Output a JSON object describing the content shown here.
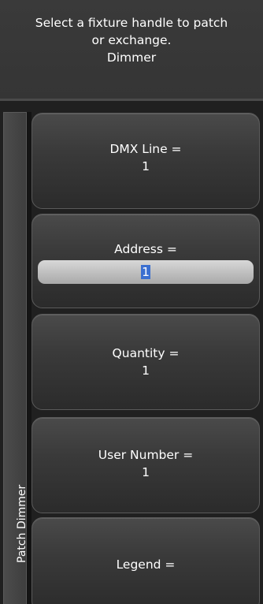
{
  "prompt": {
    "line1": "Select a fixture handle to patch",
    "line2": "or exchange.",
    "line3": "Dimmer"
  },
  "side_tab": {
    "label": "Patch Dimmer"
  },
  "softkeys": {
    "dmx_line": {
      "label": "DMX Line =",
      "value": "1"
    },
    "address": {
      "label": "Address =",
      "value": "1"
    },
    "quantity": {
      "label": "Quantity =",
      "value": "1"
    },
    "user_number": {
      "label": "User Number =",
      "value": "1"
    },
    "legend": {
      "label": "Legend ="
    }
  },
  "colors": {
    "background": "#1b1b1b",
    "button": "#3a3a3a",
    "input_field": "#c4c4c4",
    "selection": "#3b6fd0"
  }
}
